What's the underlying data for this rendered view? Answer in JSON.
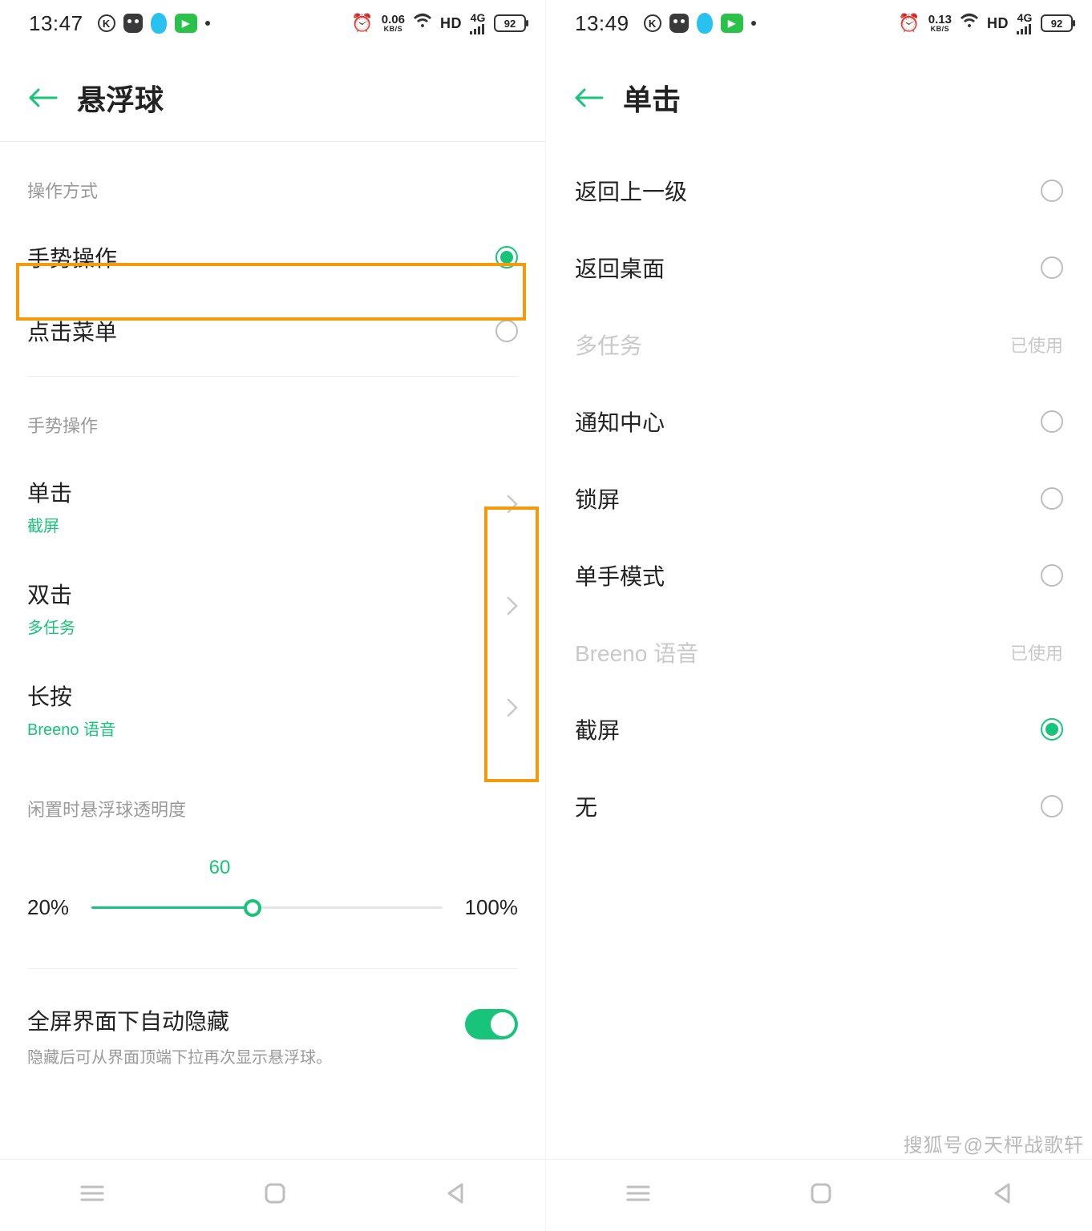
{
  "left": {
    "status": {
      "time": "13:47",
      "speed": "0.06",
      "speed_unit": "KB/S",
      "hd": "HD",
      "net": "4G",
      "battery": "92"
    },
    "header": {
      "title": "悬浮球"
    },
    "section1": {
      "label": "操作方式",
      "opt_gesture": "手势操作",
      "opt_menu": "点击菜单"
    },
    "section2": {
      "label": "手势操作",
      "tap": {
        "title": "单击",
        "sub": "截屏"
      },
      "dbltap": {
        "title": "双击",
        "sub": "多任务"
      },
      "long": {
        "title": "长按",
        "sub": "Breeno 语音"
      }
    },
    "opacity": {
      "label": "闲置时悬浮球透明度",
      "value": "60",
      "min": "20%",
      "max": "100%"
    },
    "toggle": {
      "title": "全屏界面下自动隐藏",
      "desc": "隐藏后可从界面顶端下拉再次显示悬浮球。"
    }
  },
  "right": {
    "status": {
      "time": "13:49",
      "speed": "0.13",
      "speed_unit": "KB/S",
      "hd": "HD",
      "net": "4G",
      "battery": "92"
    },
    "header": {
      "title": "单击"
    },
    "options": {
      "back": "返回上一级",
      "home": "返回桌面",
      "multitask": "多任务",
      "notif": "通知中心",
      "lock": "锁屏",
      "onehand": "单手模式",
      "breeno": "Breeno 语音",
      "screenshot": "截屏",
      "none": "无",
      "used": "已使用"
    }
  },
  "watermark": "搜狐号@天枰战歌轩"
}
